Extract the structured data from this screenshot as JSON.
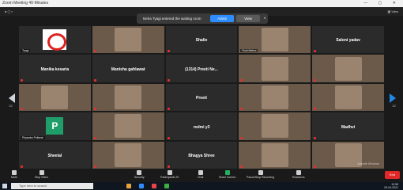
{
  "window": {
    "title": "Zoom Meeting 40-Minutes"
  },
  "notification": {
    "message": "Neha Tyagi entered the waiting room",
    "admit_label": "Admit",
    "view_label": "View"
  },
  "tiles": [
    {
      "center": "",
      "name": "Tyagi",
      "kind": "logo"
    },
    {
      "center": "",
      "name": "",
      "kind": "video"
    },
    {
      "center": "Shalie",
      "name": "",
      "kind": "text"
    },
    {
      "center": "",
      "name": "Ruhi Mehra",
      "kind": "video"
    },
    {
      "center": "Saloni yadav",
      "name": "",
      "kind": "text"
    },
    {
      "center": "Manika kesaria",
      "name": "",
      "kind": "text"
    },
    {
      "center": "Manisha gahlawat",
      "name": "",
      "kind": "text"
    },
    {
      "center": "(1314) Preeti Ne...",
      "name": "",
      "kind": "text"
    },
    {
      "center": "",
      "name": "",
      "kind": "video"
    },
    {
      "center": "",
      "name": "",
      "kind": "video"
    },
    {
      "center": "",
      "name": "",
      "kind": "video"
    },
    {
      "center": "",
      "name": "",
      "kind": "video"
    },
    {
      "center": "Preeti",
      "name": "",
      "kind": "text"
    },
    {
      "center": "",
      "name": "",
      "kind": "video"
    },
    {
      "center": "",
      "name": "",
      "kind": "video"
    },
    {
      "center": "",
      "name": "Priyanka Pulkesh",
      "kind": "p"
    },
    {
      "center": "",
      "name": "",
      "kind": "video"
    },
    {
      "center": "rodmi y3",
      "name": "",
      "kind": "text"
    },
    {
      "center": "",
      "name": "",
      "kind": "video"
    },
    {
      "center": "Madhvi",
      "name": "",
      "kind": "text"
    },
    {
      "center": "Sheetal",
      "name": "",
      "kind": "text"
    },
    {
      "center": "",
      "name": "",
      "kind": "video"
    },
    {
      "center": "Bhagya Shree",
      "name": "",
      "kind": "text"
    },
    {
      "center": "",
      "name": "",
      "kind": "video"
    },
    {
      "center": "",
      "name": "",
      "kind": "video"
    }
  ],
  "pagination": {
    "left": "1/2",
    "right": "1/2"
  },
  "toolbar": {
    "mute": "Mute",
    "video": "Stop Video",
    "security": "Security",
    "participants": "Participants",
    "participants_count": "25",
    "chat": "Chat",
    "share": "Share Screen",
    "record": "Pause/Stop Recording",
    "reactions": "Reactions",
    "end": "End"
  },
  "watermark": "Activate Windows",
  "taskbar": {
    "search_placeholder": "Type here to search",
    "time": "10:58",
    "date": "26-04-2021"
  },
  "colors": {
    "accent": "#2d8cff",
    "danger": "#e02828",
    "share": "#27ae60"
  }
}
